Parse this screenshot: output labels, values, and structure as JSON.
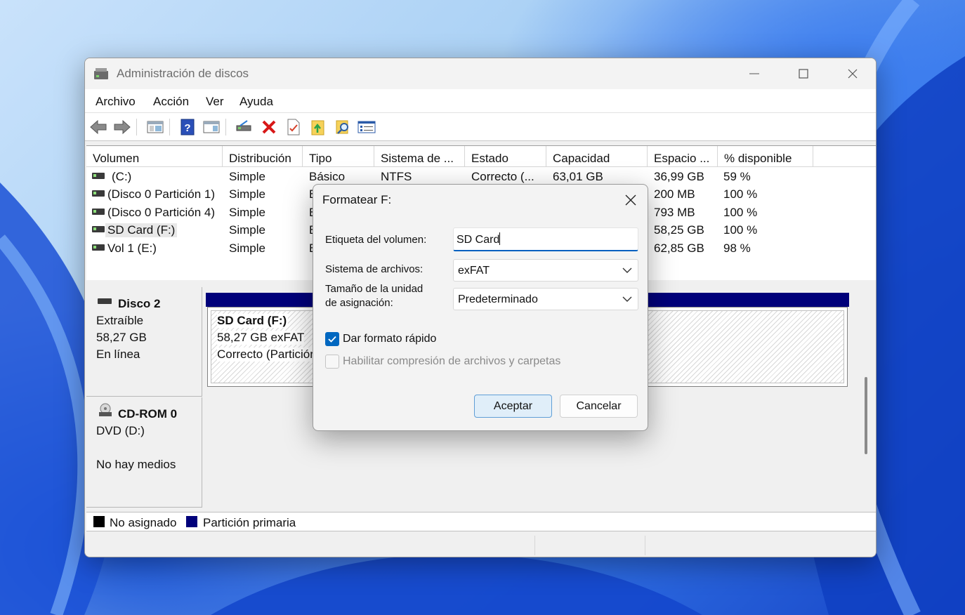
{
  "window": {
    "title": "Administración de discos",
    "controls": {
      "minimize": "—",
      "maximize": "☐",
      "close": "✕"
    }
  },
  "menu": [
    "Archivo",
    "Acción",
    "Ver",
    "Ayuda"
  ],
  "toolbar": [
    "back-arrow-icon",
    "forward-arrow-icon",
    "console-tree-icon",
    "help-icon",
    "details-icon",
    "connect-drive-icon",
    "delete-icon",
    "properties-check-icon",
    "folder-up-icon",
    "search-folder-icon",
    "list-view-icon"
  ],
  "volumes": {
    "columns": [
      "Volumen",
      "Distribución",
      "Tipo",
      "Sistema de ...",
      "Estado",
      "Capacidad",
      "Espacio ...",
      "% disponible"
    ],
    "rows": [
      {
        "volumen": "(C:)",
        "distribucion": "Simple",
        "tipo": "Básico",
        "sistema": "NTFS",
        "estado": "Correcto (...",
        "capacidad": "63,01 GB",
        "espacio": "36,99 GB",
        "disponible": "59 %"
      },
      {
        "volumen": "(Disco 0 Partición 1)",
        "distribucion": "Simple",
        "tipo": "B",
        "espacio": "200 MB",
        "disponible": "100 %"
      },
      {
        "volumen": "(Disco 0 Partición 4)",
        "distribucion": "Simple",
        "tipo": "B",
        "espacio": "793 MB",
        "disponible": "100 %"
      },
      {
        "volumen": "SD Card (F:)",
        "distribucion": "Simple",
        "tipo": "B",
        "espacio": "58,25 GB",
        "disponible": "100 %"
      },
      {
        "volumen": "Vol 1 (E:)",
        "distribucion": "Simple",
        "tipo": "B",
        "espacio": "62,85 GB",
        "disponible": "98 %"
      }
    ]
  },
  "disks": {
    "disk2": {
      "name": "Disco 2",
      "kind": "Extraíble",
      "size": "58,27 GB",
      "status": "En línea",
      "partition": {
        "name": "SD Card  (F:)",
        "fs": "58,27 GB exFAT",
        "state": "Correcto (Partición"
      }
    },
    "cdrom": {
      "name": "CD-ROM 0",
      "drive": "DVD (D:)",
      "media": "No hay medios"
    }
  },
  "legend": [
    {
      "label": "No asignado",
      "color": "#000000"
    },
    {
      "label": "Partición primaria",
      "color": "#00007a"
    }
  ],
  "dialog": {
    "title": "Formatear F:",
    "volume_label_text": "Etiqueta del volumen:",
    "volume_label_value": "SD Card",
    "fs_label": "Sistema de archivos:",
    "fs_value": "exFAT",
    "alloc_label_1": "Tamaño de la unidad",
    "alloc_label_2": "de asignación:",
    "alloc_value": "Predeterminado",
    "quick_format_label": "Dar formato rápido",
    "quick_format_checked": true,
    "compression_label": "Habilitar compresión de archivos y carpetas",
    "compression_checked": false,
    "ok_label": "Aceptar",
    "cancel_label": "Cancelar"
  },
  "colors": {
    "accent": "#0067c0",
    "primary_partition": "#00007a"
  }
}
